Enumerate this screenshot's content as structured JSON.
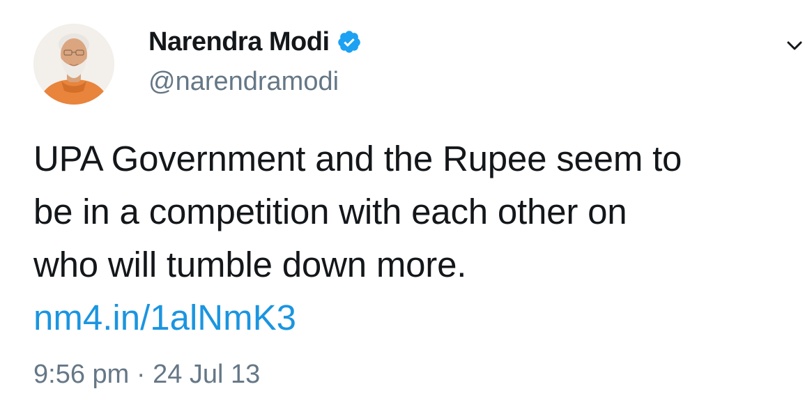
{
  "author": {
    "display_name": "Narendra Modi",
    "handle": "@narendramodi",
    "verified": true,
    "avatar_icon": "profile-photo"
  },
  "tweet": {
    "text_lines": [
      "UPA Government and the Rupee seem to",
      "be in a competition with each other on",
      "who will tumble down more."
    ],
    "link": "nm4.in/1alNmK3",
    "time": "9:56 pm",
    "separator": "·",
    "date": "24 Jul 13"
  },
  "icons": {
    "verified": "verified-badge-icon",
    "menu": "chevron-down-icon"
  },
  "colors": {
    "text": "#14171a",
    "secondary": "#657786",
    "link": "#1b95e0",
    "verified": "#1da1f2"
  }
}
